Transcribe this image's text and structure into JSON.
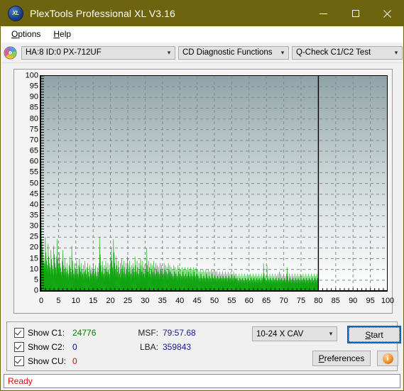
{
  "window": {
    "title": "PlexTools Professional XL V3.16",
    "icon": "xl-app-icon",
    "icon_text": "XL",
    "minimize": "minimize-icon",
    "maximize": "maximize-icon",
    "close": "close-icon",
    "titlebar_color": "#6e6410"
  },
  "menu": {
    "items": [
      {
        "label": "Options",
        "accel": "O"
      },
      {
        "label": "Help",
        "accel": "H"
      }
    ]
  },
  "toolbar": {
    "disc_icon": "cd-disc-icon",
    "drive_select": "HA:8 ID:0  PX-712UF",
    "function_select": "CD Diagnostic Functions",
    "test_select": "Q-Check C1/C2 Test"
  },
  "chart_data": {
    "type": "area",
    "title": "",
    "xlabel": "",
    "ylabel": "",
    "xlim": [
      0,
      100
    ],
    "ylim": [
      0,
      100
    ],
    "x_ticks": [
      0,
      5,
      10,
      15,
      20,
      25,
      30,
      35,
      40,
      45,
      50,
      55,
      60,
      65,
      70,
      75,
      80,
      85,
      90,
      95,
      100
    ],
    "y_ticks": [
      0,
      5,
      10,
      15,
      20,
      25,
      30,
      35,
      40,
      45,
      50,
      55,
      60,
      65,
      70,
      75,
      80,
      85,
      90,
      95,
      100
    ],
    "grid": true,
    "legend": "none",
    "series": [
      {
        "name": "C1",
        "color": "#11a511",
        "data_end_x": 80,
        "values": [
          32,
          24,
          20,
          14,
          16,
          13,
          25,
          18,
          14,
          12,
          22,
          16,
          13,
          11,
          19,
          15,
          12,
          10,
          21,
          17,
          13,
          11,
          16,
          24,
          15,
          12,
          18,
          13,
          11,
          9,
          14,
          19,
          12,
          10,
          15,
          11,
          9,
          13,
          10,
          8,
          12,
          16,
          11,
          9,
          21,
          14,
          10,
          8,
          13,
          11,
          9,
          14,
          10,
          8,
          12,
          15,
          11,
          9,
          13,
          10,
          8,
          12,
          9,
          14,
          10,
          8,
          11,
          13,
          9,
          7,
          12,
          10,
          8,
          11,
          9,
          13,
          10,
          8,
          12,
          9,
          7,
          11,
          9,
          13,
          25,
          17,
          12,
          9,
          14,
          11,
          8,
          12,
          10,
          14,
          11,
          9,
          13,
          10,
          8,
          12,
          16,
          20,
          14,
          11,
          24,
          18,
          13,
          10,
          16,
          12,
          9,
          14,
          11,
          8,
          13,
          10,
          15,
          12,
          9,
          14,
          11,
          8,
          13,
          10,
          16,
          12,
          9,
          14,
          11,
          8,
          12,
          10,
          13,
          11,
          9,
          16,
          12,
          9,
          14,
          11,
          8,
          13,
          10,
          15,
          12,
          9,
          14,
          11,
          8,
          12,
          10,
          13,
          20,
          12,
          9,
          14,
          11,
          8,
          13,
          10,
          12,
          9,
          14,
          11,
          8,
          13,
          10,
          12,
          9,
          11,
          8,
          13,
          10,
          12,
          9,
          11,
          8,
          13,
          10,
          12,
          9,
          11,
          8,
          13,
          10,
          12,
          9,
          11,
          8,
          10,
          7,
          12,
          9,
          11,
          8,
          10,
          7,
          12,
          9,
          11,
          8,
          10,
          7,
          11,
          9,
          10,
          7,
          11,
          8,
          10,
          7,
          11,
          9,
          10,
          7,
          11,
          8,
          10,
          7,
          11,
          9,
          10,
          7,
          11,
          8,
          10,
          7,
          9,
          6,
          10,
          8,
          9,
          6,
          10,
          7,
          9,
          6,
          10,
          8,
          9,
          6,
          10,
          7,
          9,
          6,
          10,
          8,
          9,
          6,
          10,
          7,
          9,
          6,
          9,
          7,
          8,
          6,
          9,
          7,
          8,
          6,
          9,
          7,
          8,
          6,
          9,
          7,
          8,
          6,
          9,
          7,
          8,
          6,
          9,
          7,
          8,
          6,
          9,
          7,
          8,
          6,
          8,
          6,
          7,
          5,
          8,
          6,
          7,
          5,
          8,
          6,
          7,
          5,
          8,
          6,
          7,
          5,
          8,
          6,
          7,
          5,
          8,
          6,
          7,
          5,
          8,
          6,
          7,
          5,
          8,
          6,
          7,
          5,
          8,
          6,
          7,
          5,
          8,
          6,
          7,
          13,
          8,
          6,
          7,
          5,
          12,
          6,
          7,
          5,
          8,
          6,
          7,
          5,
          8,
          6,
          7,
          5,
          8,
          6,
          7,
          5,
          8,
          6,
          9,
          5,
          8,
          6,
          7,
          5,
          8,
          6,
          7,
          5,
          8,
          11,
          7,
          5,
          8,
          6,
          7,
          5,
          8,
          6,
          7,
          5,
          8,
          6,
          7,
          5,
          8,
          6,
          7,
          5,
          8,
          6,
          7,
          5,
          8,
          6,
          7,
          5,
          8,
          6,
          7,
          5,
          8,
          6,
          7,
          5,
          8,
          6,
          7,
          5,
          8,
          6,
          7,
          5,
          8,
          6,
          7
        ]
      }
    ],
    "marker_lines": [
      {
        "x": 80,
        "color": "#000000"
      }
    ]
  },
  "controls": {
    "checkboxes": [
      {
        "label": "Show C1:",
        "checked": true,
        "value": "24776",
        "color": "#008000"
      },
      {
        "label": "Show C2:",
        "checked": true,
        "value": "0",
        "color": "#0000cd"
      },
      {
        "label": "Show CU:",
        "checked": true,
        "value": "0",
        "color": "#e00000"
      }
    ],
    "readouts": [
      {
        "label": "MSF:",
        "value": "79:57.68"
      },
      {
        "label": "LBA:",
        "value": "359843"
      }
    ],
    "speed_select": "10-24 X CAV",
    "start_button": "Start",
    "start_accel": "S",
    "preferences_button": "Preferences",
    "preferences_accel": "P",
    "info_button": "info-icon",
    "info_glyph": "i"
  },
  "statusbar": {
    "text": "Ready",
    "color": "#e8000d"
  }
}
